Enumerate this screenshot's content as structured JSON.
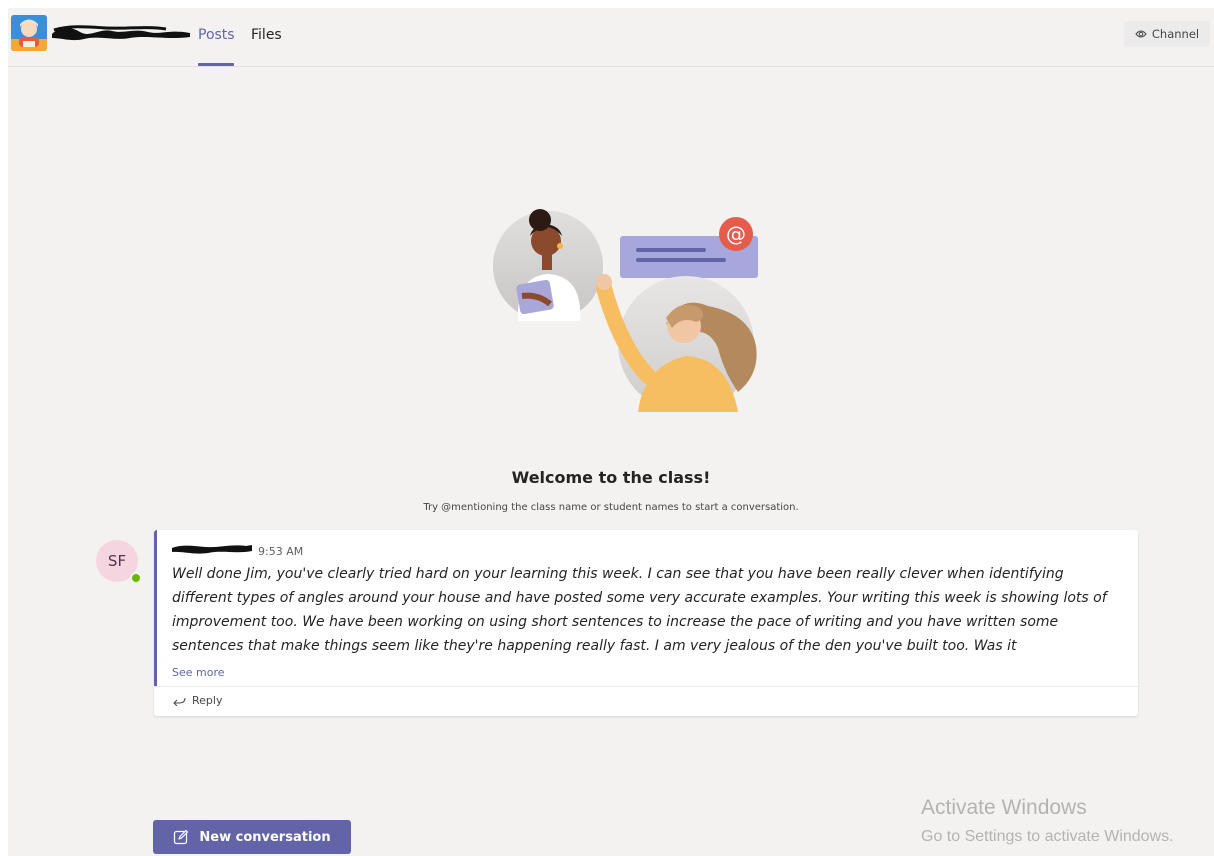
{
  "header": {
    "tabs": [
      {
        "label": "Posts",
        "active": true
      },
      {
        "label": "Files",
        "active": false
      }
    ],
    "channel_button": {
      "label": "Channel",
      "icon": "eye-icon"
    }
  },
  "welcome": {
    "title": "Welcome to the class!",
    "subtitle": "Try @mentioning the class name or student names to start a conversation."
  },
  "post": {
    "author_initials": "SF",
    "time": "9:53 AM",
    "body": "Well done Jim, you've clearly tried hard on your learning this week. I can see that you have been really clever when identifying different types of angles around your house and have posted some very accurate examples. Your writing this week is showing lots of improvement too. We have been working on using short sentences to increase the pace of writing and you have written some sentences that make things seem like they're happening really fast. I am very jealous of the den you've built too. Was it",
    "see_more": "See more",
    "reply": "Reply"
  },
  "new_conversation": {
    "label": "New conversation",
    "icon": "compose-icon"
  },
  "watermark": {
    "title": "Activate Windows",
    "subtitle": "Go to Settings to activate Windows."
  },
  "colors": {
    "accent": "#6264a7",
    "background": "#f3f2f1",
    "presence": "#6bb700"
  }
}
